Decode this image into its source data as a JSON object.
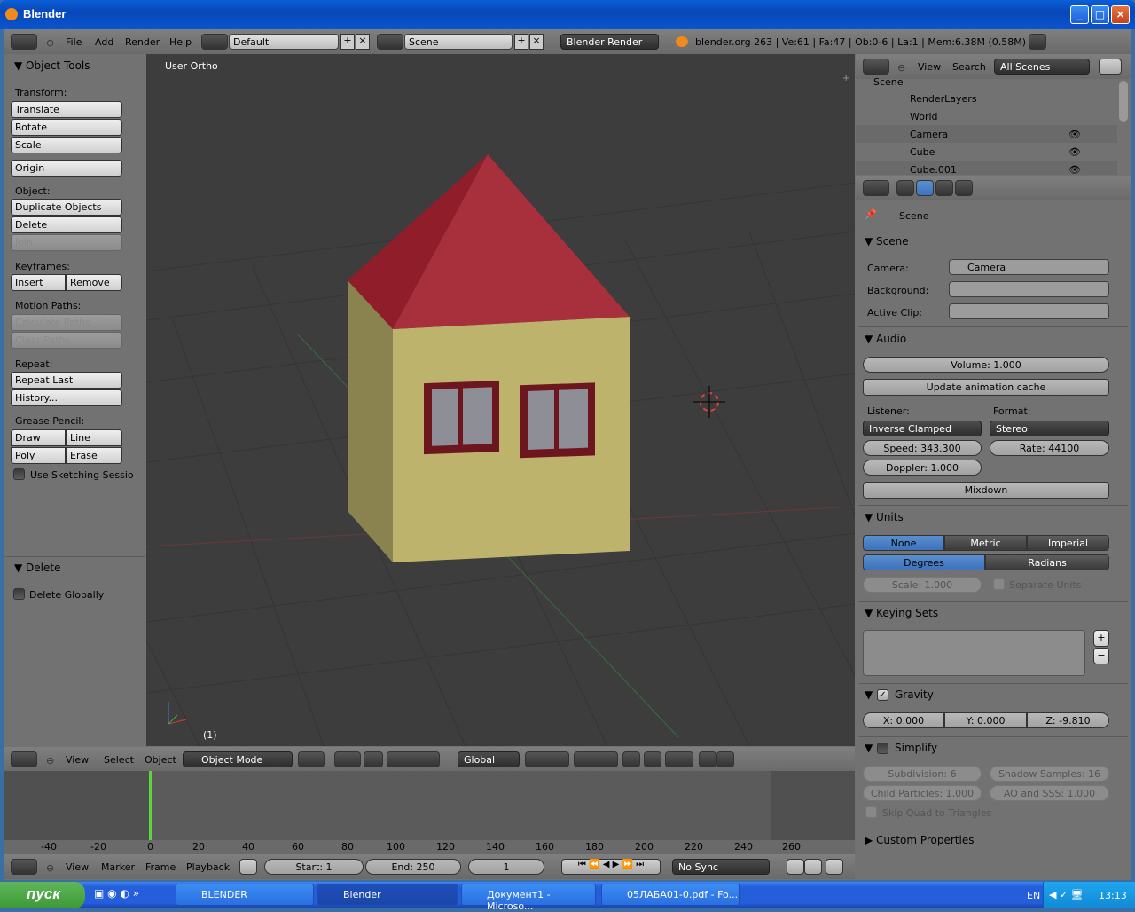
{
  "window": {
    "title": "Blender",
    "min": "_",
    "max": "□",
    "close": "×"
  },
  "info_header": {
    "menus": [
      "File",
      "Add",
      "Render",
      "Help"
    ],
    "layout": "Default",
    "scene": "Scene",
    "engine": "Blender Render",
    "stats": "blender.org 263 | Ve:61 | Fa:47 | Ob:0-6 | La:1 | Mem:6.38M (0.58M)"
  },
  "toolshelf": {
    "title": "Object Tools",
    "transform_label": "Transform:",
    "translate": "Translate",
    "rotate": "Rotate",
    "scale": "Scale",
    "origin": "Origin",
    "object_label": "Object:",
    "duplicate": "Duplicate Objects",
    "delete": "Delete",
    "join": "Join",
    "keyframes_label": "Keyframes:",
    "insert": "Insert",
    "remove": "Remove",
    "motion_label": "Motion Paths:",
    "calc_paths": "Calculate Paths",
    "clear_paths": "Clear Paths",
    "repeat_label": "Repeat:",
    "repeat_last": "Repeat Last",
    "history": "History...",
    "grease_label": "Grease Pencil:",
    "draw": "Draw",
    "line": "Line",
    "poly": "Poly",
    "erase": "Erase",
    "sketching": "Use Sketching Sessio",
    "delete_panel": "Delete",
    "delete_globally": "Delete Globally"
  },
  "viewport": {
    "view_label": "User Ortho",
    "frame_label": "(1)"
  },
  "view3d_header": {
    "menus": [
      "View",
      "Select",
      "Object"
    ],
    "mode": "Object Mode",
    "orientation": "Global"
  },
  "timeline": {
    "ticks": [
      "-40",
      "-20",
      "0",
      "20",
      "40",
      "60",
      "80",
      "100",
      "120",
      "140",
      "160",
      "180",
      "200",
      "220",
      "240",
      "260"
    ],
    "menus": [
      "View",
      "Marker",
      "Frame",
      "Playback"
    ],
    "start": "Start: 1",
    "end": "End: 250",
    "current": "1",
    "sync": "No Sync"
  },
  "outliner": {
    "menus": [
      "View",
      "Search"
    ],
    "filter": "All Scenes",
    "items": [
      "Scene",
      "RenderLayers",
      "World",
      "Camera",
      "Cube",
      "Cube.001"
    ]
  },
  "properties": {
    "breadcrumb": "Scene",
    "scene_panel": "Scene",
    "camera_label": "Camera:",
    "camera_value": "Camera",
    "background_label": "Background:",
    "active_clip_label": "Active Clip:",
    "audio_panel": "Audio",
    "volume": "Volume: 1.000",
    "update_cache": "Update animation cache",
    "listener_label": "Listener:",
    "listener_value": "Inverse Clamped",
    "format_label": "Format:",
    "format_value": "Stereo",
    "speed": "Speed: 343.300",
    "rate": "Rate: 44100",
    "doppler": "Doppler: 1.000",
    "mixdown": "Mixdown",
    "units_panel": "Units",
    "unit_none": "None",
    "unit_metric": "Metric",
    "unit_imperial": "Imperial",
    "degrees": "Degrees",
    "radians": "Radians",
    "scale": "Scale: 1.000",
    "separate_units": "Separate Units",
    "keying_panel": "Keying Sets",
    "gravity_panel": "Gravity",
    "gx": "X: 0.000",
    "gy": "Y: 0.000",
    "gz": "Z: -9.810",
    "simplify_panel": "Simplify",
    "subdivision": "Subdivision: 6",
    "shadow_samples": "Shadow Samples: 16",
    "child_particles": "Child Particles: 1.000",
    "ao_sss": "AO and SSS: 1.000",
    "skip_quad": "Skip Quad to Triangles",
    "custom_panel": "Custom Properties"
  },
  "taskbar": {
    "start": "пуск",
    "tasks": [
      "BLENDER",
      "Blender",
      "Документ1 - Microso...",
      "05ЛАБА01-0.pdf - Fo..."
    ],
    "lang": "EN",
    "time": "13:13"
  }
}
